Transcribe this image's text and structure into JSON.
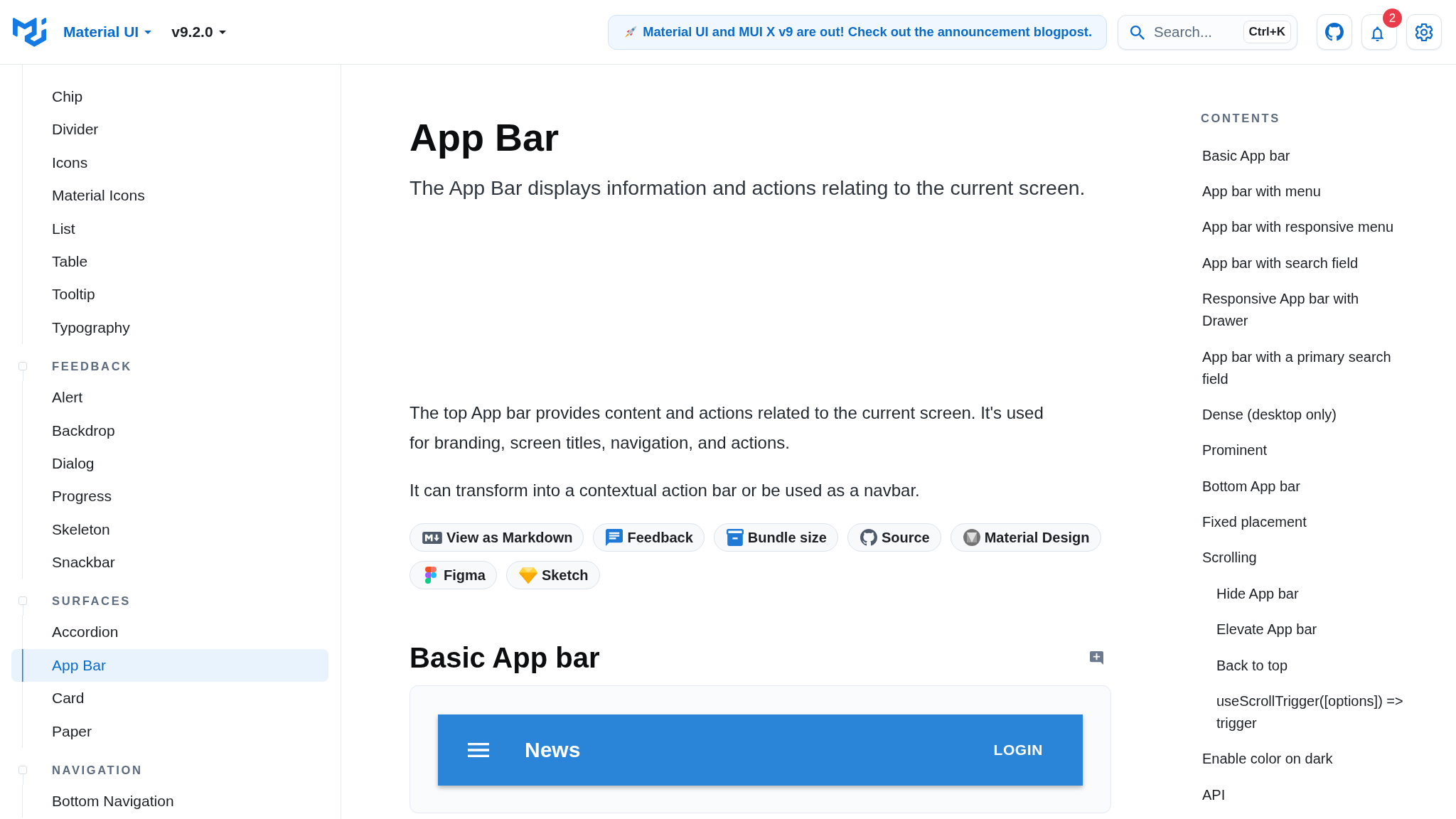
{
  "header": {
    "product": "Material UI",
    "version": "v9.2.0",
    "announcement": "Material UI and MUI X v9 are out! Check out the announcement blogpost.",
    "search": {
      "placeholder": "Search...",
      "shortcut": "Ctrl+K"
    },
    "notifications": {
      "count": "2"
    }
  },
  "sidebar": {
    "groups": [
      {
        "items": [
          {
            "label": "Chip",
            "selected": false
          },
          {
            "label": "Divider",
            "selected": false
          },
          {
            "label": "Icons",
            "selected": false
          },
          {
            "label": "Material Icons",
            "selected": false
          },
          {
            "label": "List",
            "selected": false
          },
          {
            "label": "Table",
            "selected": false
          },
          {
            "label": "Tooltip",
            "selected": false
          },
          {
            "label": "Typography",
            "selected": false
          }
        ]
      },
      {
        "title": "FEEDBACK",
        "items": [
          {
            "label": "Alert",
            "selected": false
          },
          {
            "label": "Backdrop",
            "selected": false
          },
          {
            "label": "Dialog",
            "selected": false
          },
          {
            "label": "Progress",
            "selected": false
          },
          {
            "label": "Skeleton",
            "selected": false
          },
          {
            "label": "Snackbar",
            "selected": false
          }
        ]
      },
      {
        "title": "SURFACES",
        "items": [
          {
            "label": "Accordion",
            "selected": false
          },
          {
            "label": "App Bar",
            "selected": true
          },
          {
            "label": "Card",
            "selected": false
          },
          {
            "label": "Paper",
            "selected": false
          }
        ]
      },
      {
        "title": "NAVIGATION",
        "items": [
          {
            "label": "Bottom Navigation",
            "selected": false
          }
        ]
      }
    ]
  },
  "page": {
    "title": "App Bar",
    "description": "The App Bar displays information and actions relating to the current screen.",
    "paragraphs": [
      "The top App bar provides content and actions related to the current screen. It's used for branding, screen titles, navigation, and actions.",
      "It can transform into a contextual action bar or be used as a navbar."
    ],
    "resource_links": [
      {
        "label": "View as Markdown",
        "kind": "markdown"
      },
      {
        "label": "Feedback",
        "kind": "feedback"
      },
      {
        "label": "Bundle size",
        "kind": "bundle"
      },
      {
        "label": "Source",
        "kind": "source"
      },
      {
        "label": "Material Design",
        "kind": "material"
      },
      {
        "label": "Figma",
        "kind": "figma"
      },
      {
        "label": "Sketch",
        "kind": "sketch"
      }
    ],
    "sections": [
      {
        "heading": "Basic App bar",
        "demo": {
          "title": "News",
          "action": "LOGIN"
        }
      }
    ]
  },
  "contents": {
    "title": "CONTENTS",
    "items": [
      {
        "label": "Basic App bar"
      },
      {
        "label": "App bar with menu"
      },
      {
        "label": "App bar with responsive menu"
      },
      {
        "label": "App bar with search field"
      },
      {
        "label": "Responsive App bar with Drawer"
      },
      {
        "label": "App bar with a primary search field"
      },
      {
        "label": "Dense (desktop only)"
      },
      {
        "label": "Prominent"
      },
      {
        "label": "Bottom App bar"
      },
      {
        "label": "Fixed placement"
      },
      {
        "label": "Scrolling",
        "children": [
          {
            "label": "Hide App bar"
          },
          {
            "label": "Elevate App bar"
          },
          {
            "label": "Back to top"
          },
          {
            "label": "useScrollTrigger([options]) => trigger"
          }
        ]
      },
      {
        "label": "Enable color on dark"
      },
      {
        "label": "API"
      }
    ]
  }
}
